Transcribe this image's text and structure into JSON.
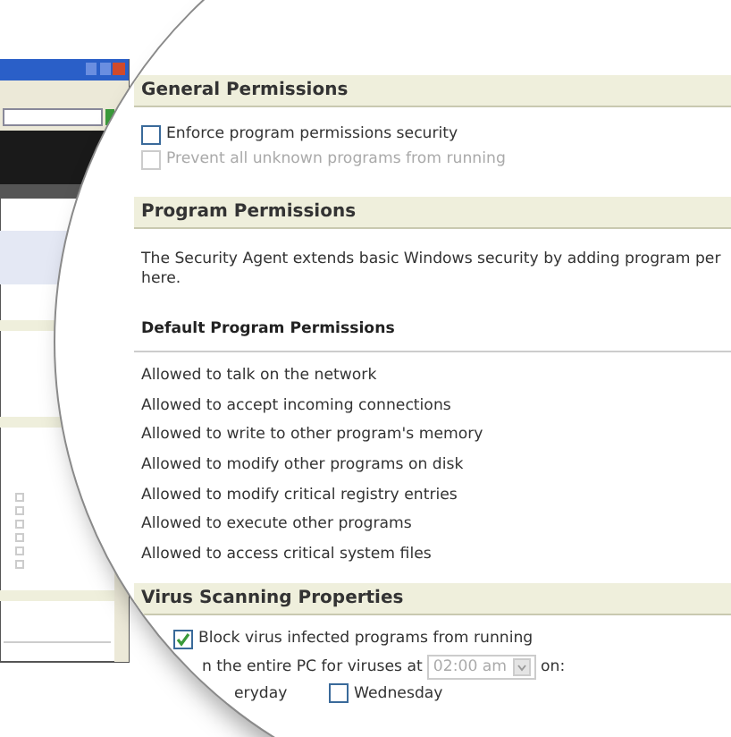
{
  "general_permissions": {
    "title": "General Permissions",
    "options": [
      {
        "label": "Enforce program permissions security",
        "checked": false,
        "disabled": false
      },
      {
        "label": "Prevent all unknown programs from running",
        "checked": false,
        "disabled": true
      }
    ]
  },
  "program_permissions": {
    "title": "Program Permissions",
    "description_lines": [
      "The Security Agent extends basic Windows security by adding program per",
      "here."
    ],
    "subtitle": "Default Program Permissions",
    "items": [
      "Allowed to talk on the network",
      "Allowed to accept incoming connections",
      "Allowed to write to other program's memory",
      "Allowed to modify other programs on disk",
      "Allowed to modify critical registry entries",
      "Allowed to execute other programs",
      "Allowed to access critical system files"
    ]
  },
  "virus_scanning": {
    "title": "Virus Scanning Properties",
    "block": {
      "label": "Block virus infected programs from running",
      "checked": true
    },
    "scan": {
      "label": "n the entire PC for viruses at",
      "time": "02:00 am",
      "suffix": "on:"
    },
    "days_fragment": "eryday",
    "wednesday": {
      "label": "Wednesday",
      "checked": false
    }
  }
}
